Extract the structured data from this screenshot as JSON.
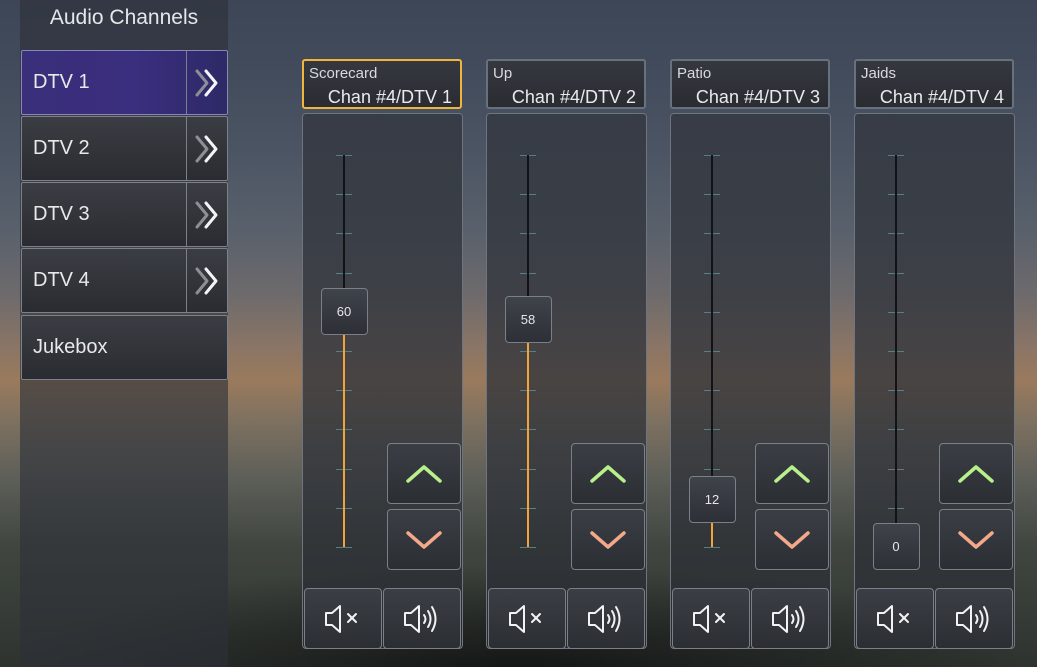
{
  "sidebar": {
    "title": "Audio Channels",
    "items": [
      {
        "label": "DTV 1",
        "active": true,
        "has_arrow": true
      },
      {
        "label": "DTV 2",
        "active": false,
        "has_arrow": true
      },
      {
        "label": "DTV 3",
        "active": false,
        "has_arrow": true
      },
      {
        "label": "DTV 4",
        "active": false,
        "has_arrow": true
      },
      {
        "label": "Jukebox",
        "active": false,
        "has_arrow": false
      }
    ]
  },
  "strips": [
    {
      "name": "Scorecard",
      "channel": "Chan #4/DTV 1",
      "volume": 60,
      "volume_label": "60",
      "selected": true
    },
    {
      "name": "Up",
      "channel": "Chan #4/DTV 2",
      "volume": 58,
      "volume_label": "58",
      "selected": false
    },
    {
      "name": "Patio",
      "channel": "Chan #4/DTV 3",
      "volume": 12,
      "volume_label": "12",
      "selected": false
    },
    {
      "name": "Jaids",
      "channel": "Chan #4/DTV 4",
      "volume": 0,
      "volume_label": "0",
      "selected": false
    }
  ],
  "icons": {
    "nav_arrow": "double-chevron-right-icon",
    "volume_up": "chevron-up-icon",
    "volume_down": "chevron-down-icon",
    "mute": "speaker-mute-icon",
    "unmute": "speaker-loud-icon"
  },
  "colors": {
    "active_nav": "#3a2e7e",
    "selected_border": "#f0b53c",
    "level_fill": "#f0a43a",
    "up_arrow": "#b8f08a",
    "down_arrow": "#f4a88a"
  }
}
